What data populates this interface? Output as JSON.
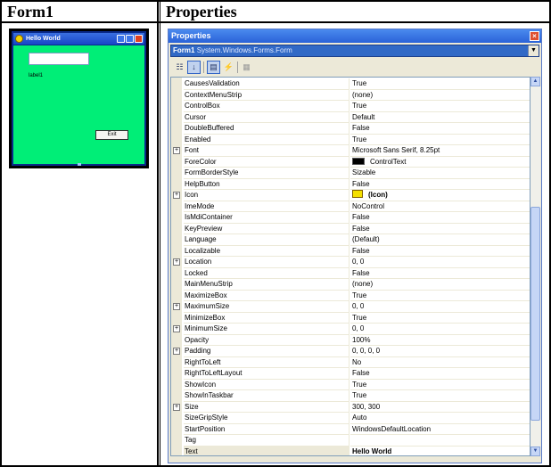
{
  "headers": {
    "left": "Form1",
    "right": "Properties"
  },
  "form_preview": {
    "title": "Hello World",
    "label_text": "label1",
    "button_text": "Exit",
    "client_color": "#00ee77"
  },
  "properties_window": {
    "title": "Properties",
    "object_name": "Form1",
    "object_type": "System.Windows.Forms.Form",
    "rows": [
      {
        "name": "CausesValidation",
        "value": "True"
      },
      {
        "name": "ContextMenuStrip",
        "value": "(none)"
      },
      {
        "name": "ControlBox",
        "value": "True"
      },
      {
        "name": "Cursor",
        "value": "Default"
      },
      {
        "name": "DoubleBuffered",
        "value": "False"
      },
      {
        "name": "Enabled",
        "value": "True"
      },
      {
        "name": "Font",
        "value": "Microsoft Sans Serif, 8.25pt"
      },
      {
        "name": "ForeColor",
        "value": "ControlText"
      },
      {
        "name": "FormBorderStyle",
        "value": "Sizable"
      },
      {
        "name": "HelpButton",
        "value": "False"
      },
      {
        "name": "Icon",
        "value": "(Icon)"
      },
      {
        "name": "ImeMode",
        "value": "NoControl"
      },
      {
        "name": "IsMdiContainer",
        "value": "False"
      },
      {
        "name": "KeyPreview",
        "value": "False"
      },
      {
        "name": "Language",
        "value": "(Default)"
      },
      {
        "name": "Localizable",
        "value": "False"
      },
      {
        "name": "Location",
        "value": "0, 0"
      },
      {
        "name": "Locked",
        "value": "False"
      },
      {
        "name": "MainMenuStrip",
        "value": "(none)"
      },
      {
        "name": "MaximizeBox",
        "value": "True"
      },
      {
        "name": "MaximumSize",
        "value": "0, 0"
      },
      {
        "name": "MinimizeBox",
        "value": "True"
      },
      {
        "name": "MinimumSize",
        "value": "0, 0"
      },
      {
        "name": "Opacity",
        "value": "100%"
      },
      {
        "name": "Padding",
        "value": "0, 0, 0, 0"
      },
      {
        "name": "RightToLeft",
        "value": "No"
      },
      {
        "name": "RightToLeftLayout",
        "value": "False"
      },
      {
        "name": "ShowIcon",
        "value": "True"
      },
      {
        "name": "ShowInTaskbar",
        "value": "True"
      },
      {
        "name": "Size",
        "value": "300, 300"
      },
      {
        "name": "SizeGripStyle",
        "value": "Auto"
      },
      {
        "name": "StartPosition",
        "value": "WindowsDefaultLocation"
      },
      {
        "name": "Tag",
        "value": ""
      },
      {
        "name": "Text",
        "value": "Hello World"
      }
    ]
  }
}
